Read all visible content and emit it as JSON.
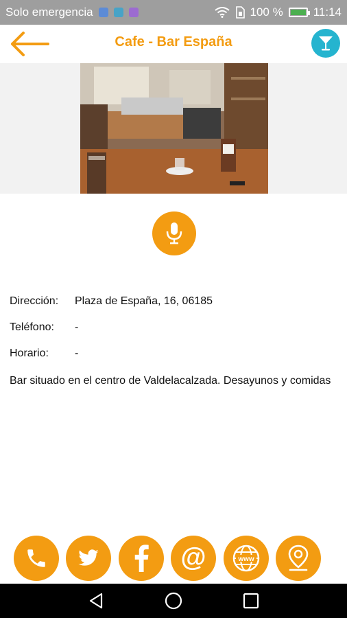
{
  "status": {
    "carrier": "Solo emergencia",
    "battery": "100 %",
    "time": "11:14",
    "notif_colors": [
      "#5c8bd6",
      "#47a3c7",
      "#9c6bd1"
    ]
  },
  "header": {
    "title": "Cafe - Bar España",
    "back_icon": "arrow-left-icon",
    "right_icon": "cocktail-icon"
  },
  "colors": {
    "accent": "#f39c12",
    "cyan": "#25b4cf"
  },
  "details": {
    "address_label": "Dirección:",
    "address_value": "Plaza de España, 16, 06185",
    "phone_label": "Teléfono:",
    "phone_value": "-",
    "hours_label": "Horario:",
    "hours_value": "-",
    "description": "Bar situado en el centro de Valdelacalzada. Desayunos y comidas"
  },
  "social_buttons": [
    "phone-icon",
    "twitter-icon",
    "facebook-icon",
    "email-at-icon",
    "web-icon",
    "location-pin-icon"
  ],
  "nav": [
    "back-triangle-icon",
    "home-circle-icon",
    "recents-square-icon"
  ]
}
